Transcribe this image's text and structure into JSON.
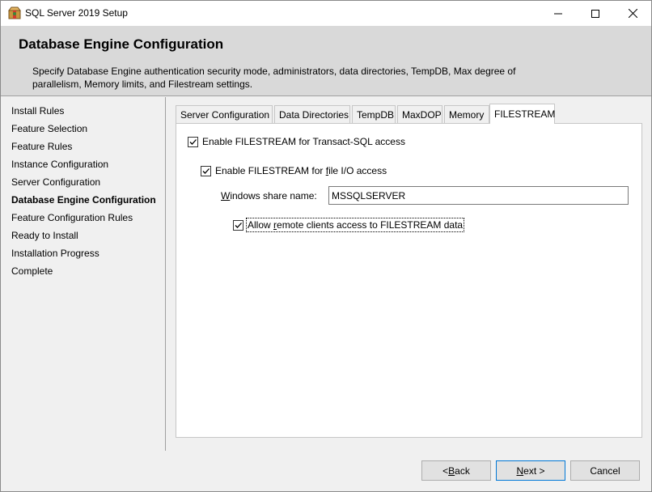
{
  "window": {
    "title": "SQL Server 2019 Setup",
    "icon": "sql-server-setup-icon"
  },
  "header": {
    "title": "Database Engine Configuration",
    "description": "Specify Database Engine authentication security mode, administrators, data directories, TempDB, Max degree of parallelism, Memory limits, and Filestream settings."
  },
  "sidebar": {
    "items": [
      {
        "label": "Install Rules",
        "active": false
      },
      {
        "label": "Feature Selection",
        "active": false
      },
      {
        "label": "Feature Rules",
        "active": false
      },
      {
        "label": "Instance Configuration",
        "active": false
      },
      {
        "label": "Server Configuration",
        "active": false
      },
      {
        "label": "Database Engine Configuration",
        "active": true
      },
      {
        "label": "Feature Configuration Rules",
        "active": false
      },
      {
        "label": "Ready to Install",
        "active": false
      },
      {
        "label": "Installation Progress",
        "active": false
      },
      {
        "label": "Complete",
        "active": false
      }
    ]
  },
  "tabs": [
    {
      "label": "Server Configuration",
      "active": false
    },
    {
      "label": "Data Directories",
      "active": false
    },
    {
      "label": "TempDB",
      "active": false
    },
    {
      "label": "MaxDOP",
      "active": false
    },
    {
      "label": "Memory",
      "active": false
    },
    {
      "label": "FILESTREAM",
      "active": true
    }
  ],
  "filestream": {
    "enable_tsql": {
      "label_pre": "Enable FILESTREAM for Transact-SQL access",
      "checked": true
    },
    "enable_file_io": {
      "label_pre": "Enable FILESTREAM for ",
      "label_u": "f",
      "label_post": "ile I/O access",
      "checked": true
    },
    "share_name": {
      "label_u": "W",
      "label_post": "indows share name:",
      "value": "MSSQLSERVER"
    },
    "remote_clients": {
      "label_pre": "Allow ",
      "label_u": "r",
      "label_post": "emote clients access to FILESTREAM data",
      "checked": true
    }
  },
  "footer": {
    "back": {
      "pre": "< ",
      "u": "B",
      "post": "ack"
    },
    "next": {
      "pre": "",
      "u": "N",
      "post": "ext >"
    },
    "cancel": "Cancel"
  }
}
